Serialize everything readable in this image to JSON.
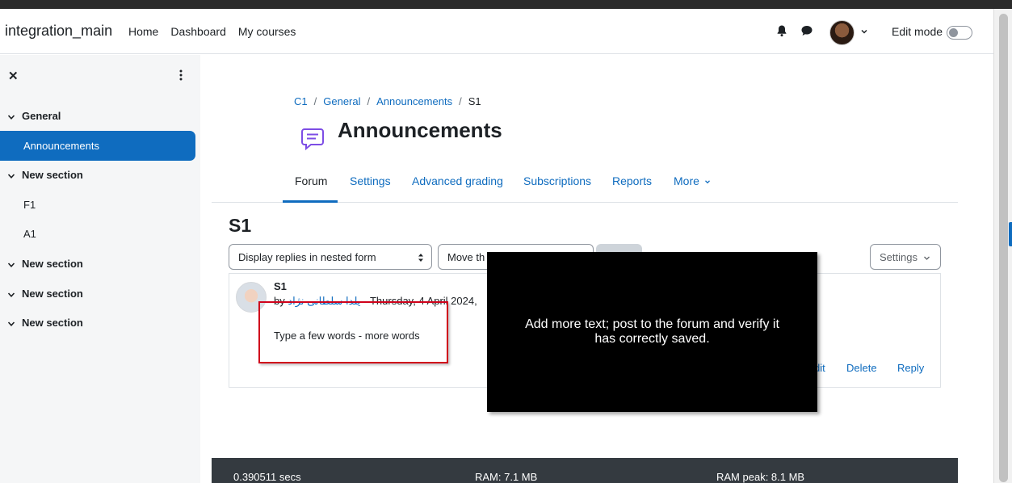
{
  "navbar": {
    "site_name": "integration_main",
    "links": [
      "Home",
      "Dashboard",
      "My courses"
    ],
    "edit_mode_label": "Edit mode"
  },
  "drawer": {
    "items": [
      {
        "label": "General",
        "type": "section"
      },
      {
        "label": "Announcements",
        "type": "activity",
        "active": true
      },
      {
        "label": "New section",
        "type": "section"
      },
      {
        "label": "F1",
        "type": "activity"
      },
      {
        "label": "A1",
        "type": "activity"
      },
      {
        "label": "New section",
        "type": "section"
      },
      {
        "label": "New section",
        "type": "section"
      },
      {
        "label": "New section",
        "type": "section"
      }
    ]
  },
  "breadcrumb": [
    "C1",
    "General",
    "Announcements",
    "S1"
  ],
  "page": {
    "title": "Announcements",
    "tabs": [
      "Forum",
      "Settings",
      "Advanced grading",
      "Subscriptions",
      "Reports",
      "More"
    ],
    "active_tab": "Forum"
  },
  "discussion": {
    "title": "S1",
    "display_mode": "Display replies in nested form",
    "move_label": "Move th",
    "settings_label": "Settings"
  },
  "post": {
    "subject": "S1",
    "by": "by",
    "author": "یلدا سلطانی نژاد",
    "date": "- Thursday, 4 April 2024,",
    "body": "Type a few words - more words",
    "actions": [
      "dit",
      "Delete",
      "Reply"
    ]
  },
  "tooltip": {
    "text": "Add more text; post to the forum and verify it has correctly saved."
  },
  "footer": {
    "time": "0.390511 secs",
    "ram": "RAM: 7.1 MB",
    "ram_peak": "RAM peak: 8.1 MB"
  },
  "colors": {
    "accent": "#0f6cbf",
    "drawer_bg": "#f5f6f7",
    "highlight": "#d0021b",
    "footer_bg": "#343a40",
    "activity_icon": "#7d4de5"
  },
  "icons": {
    "close": "close-icon",
    "kebab": "kebab-menu-icon",
    "bell": "bell-icon",
    "chat": "chat-icon",
    "chevron": "chevron-down-icon",
    "forum": "forum-icon"
  }
}
